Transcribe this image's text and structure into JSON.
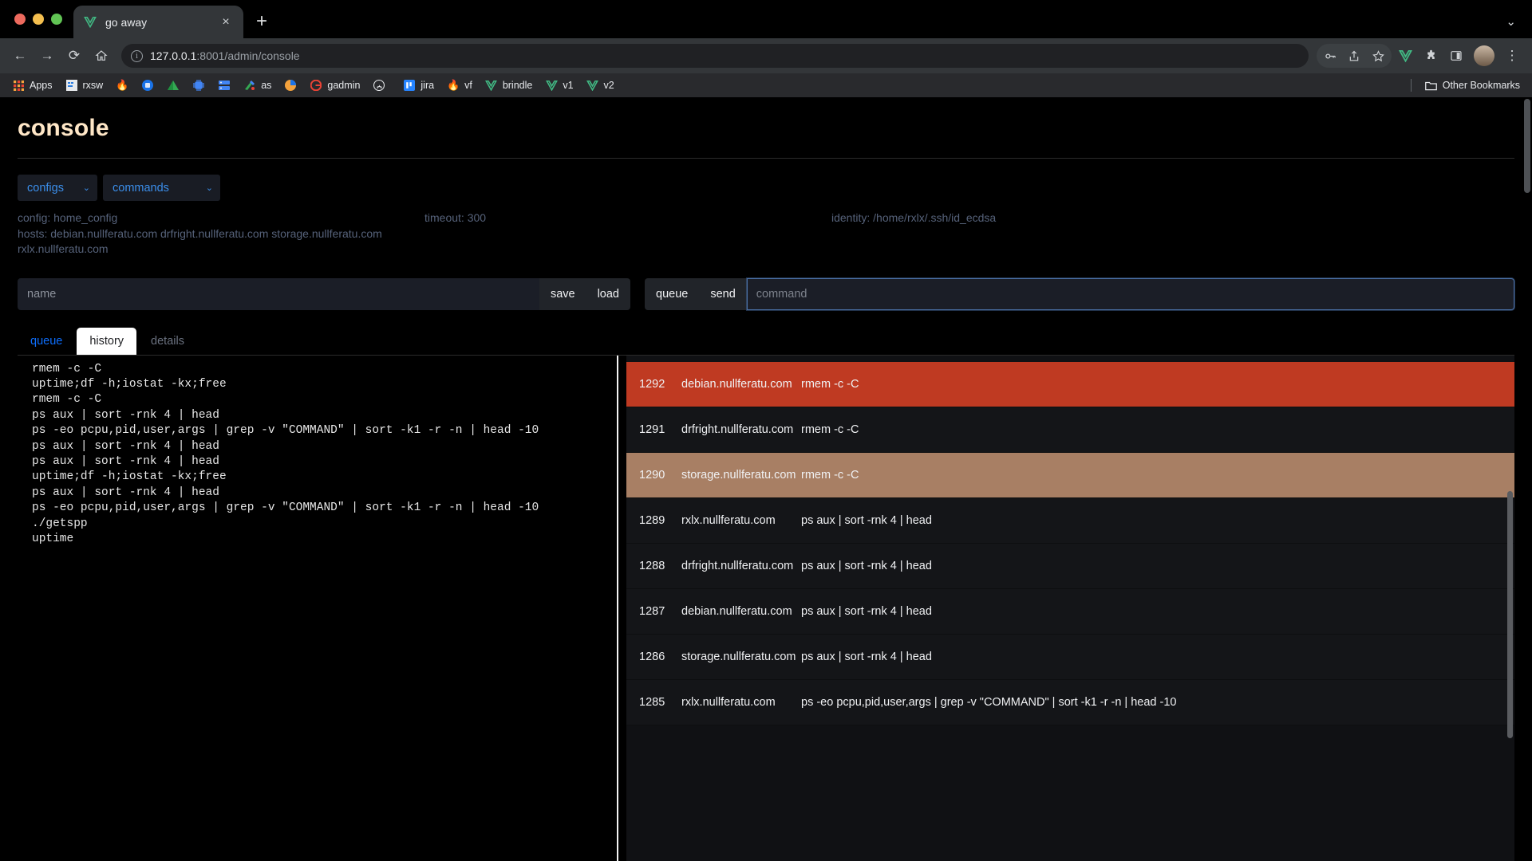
{
  "browser": {
    "tab": {
      "title": "go away",
      "favicon": "vue-logo-icon",
      "close": "×"
    },
    "newtab_label": "+",
    "window_chevron": "⌄",
    "nav": {
      "back": "←",
      "forward": "→",
      "reload": "⟳",
      "home": "⌂"
    },
    "url": {
      "host": "127.0.0.1",
      "rest": ":8001/admin/console",
      "full": "127.0.0.1:8001/admin/console"
    },
    "toolbar_right": [
      "key-icon",
      "share-icon",
      "star-icon",
      "vue-extension-icon",
      "puzzle-extension-icon",
      "sidepanel-icon",
      "avatar",
      "menu-icon"
    ],
    "bookmarks": [
      {
        "label": "Apps",
        "icon": "apps-grid-icon"
      },
      {
        "label": "rxsw",
        "icon": "docs-icon"
      },
      {
        "label": "",
        "icon": "fire-icon"
      },
      {
        "label": "",
        "icon": "blue-shield-icon"
      },
      {
        "label": "",
        "icon": "drive-icon"
      },
      {
        "label": "",
        "icon": "chip-icon"
      },
      {
        "label": "",
        "icon": "server-icon"
      },
      {
        "label": "as",
        "icon": "colorful-icon"
      },
      {
        "label": "",
        "icon": "orange-circle-icon"
      },
      {
        "label": "gadmin",
        "icon": "google-icon"
      },
      {
        "label": "",
        "icon": "github-icon"
      },
      {
        "label": "jira",
        "icon": "jira-icon"
      },
      {
        "label": "vf",
        "icon": "flame-icon"
      },
      {
        "label": "brindle",
        "icon": "vue-icon"
      },
      {
        "label": "v1",
        "icon": "vue-icon"
      },
      {
        "label": "v2",
        "icon": "vue-icon"
      }
    ],
    "other_bookmarks": {
      "label": "Other Bookmarks",
      "icon": "folder-icon"
    }
  },
  "app": {
    "title": "console",
    "selects": {
      "configs": {
        "value": "configs",
        "chevron": "⌄"
      },
      "commands": {
        "value": "commands",
        "chevron": "⌄"
      }
    },
    "meta": {
      "config": "config: home_config",
      "hosts_line1": "hosts: debian.nullferatu.com drfright.nullferatu.com storage.nullferatu.com",
      "hosts_line2": "rxlx.nullferatu.com",
      "timeout": "timeout: 300",
      "identity": "identity: /home/rxlx/.ssh/id_ecdsa"
    },
    "name_input": {
      "value": "",
      "placeholder": "name"
    },
    "save_label": "save",
    "load_label": "load",
    "queue_label": "queue",
    "send_label": "send",
    "command_input": {
      "value": "",
      "placeholder": "command"
    },
    "tabs": [
      {
        "label": "queue",
        "active": false
      },
      {
        "label": "history",
        "active": true
      },
      {
        "label": "details",
        "active": false
      }
    ],
    "terminal_lines": [
      "rmem -c -C",
      "uptime;df -h;iostat -kx;free",
      "rmem -c -C",
      "ps aux | sort -rnk 4 | head",
      "ps -eo pcpu,pid,user,args | grep -v \"COMMAND\" | sort -k1 -r -n | head -10",
      "ps aux | sort -rnk 4 | head",
      "ps aux | sort -rnk 4 | head",
      "uptime;df -h;iostat -kx;free",
      "ps aux | sort -rnk 4 | head",
      "ps -eo pcpu,pid,user,args | grep -v \"COMMAND\" | sort -k1 -r -n | head -10",
      "./getspp",
      "uptime"
    ],
    "history": [
      {
        "id": "1292",
        "host": "debian.nullferatu.com",
        "cmd": "rmem -c -C",
        "highlight": "red"
      },
      {
        "id": "1291",
        "host": "drfright.nullferatu.com",
        "cmd": "rmem -c -C",
        "highlight": "none"
      },
      {
        "id": "1290",
        "host": "storage.nullferatu.com",
        "cmd": "rmem -c -C",
        "highlight": "brown"
      },
      {
        "id": "1289",
        "host": "rxlx.nullferatu.com",
        "cmd": "ps aux | sort -rnk 4 | head",
        "highlight": "none"
      },
      {
        "id": "1288",
        "host": "drfright.nullferatu.com",
        "cmd": "ps aux | sort -rnk 4 | head",
        "highlight": "none"
      },
      {
        "id": "1287",
        "host": "debian.nullferatu.com",
        "cmd": "ps aux | sort -rnk 4 | head",
        "highlight": "none"
      },
      {
        "id": "1286",
        "host": "storage.nullferatu.com",
        "cmd": "ps aux | sort -rnk 4 | head",
        "highlight": "none"
      },
      {
        "id": "1285",
        "host": "rxlx.nullferatu.com",
        "cmd": "ps -eo pcpu,pid,user,args | grep -v \"COMMAND\" | sort -k1 -r -n | head -10",
        "highlight": "none"
      }
    ]
  },
  "colors": {
    "accent_blue": "#0d6efd",
    "title_cream": "#ffe7c7",
    "highlight_red": "#bf3a22",
    "highlight_brown": "#a87f64",
    "meta_text": "#56627a"
  }
}
